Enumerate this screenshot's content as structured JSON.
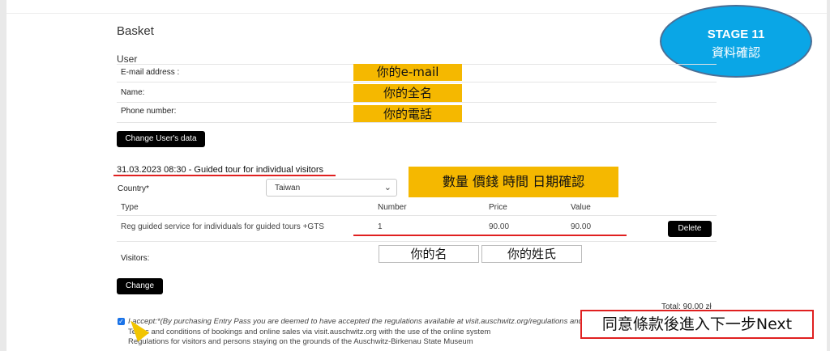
{
  "page": {
    "title": "Basket",
    "user_section": "User",
    "fields": [
      {
        "label": "E-mail address :",
        "annotation": "你的e-mail"
      },
      {
        "label": "Name:",
        "annotation": "你的全名"
      },
      {
        "label": "Phone number:",
        "annotation": "你的電話"
      }
    ],
    "change_user_button": "Change User's data"
  },
  "stage": {
    "line1": "STAGE 11",
    "line2": "資料確認"
  },
  "booking": {
    "heading": "31.03.2023 08:30 - Guided tour for individual visitors",
    "confirm_annotation": "數量 價錢 時間 日期確認",
    "country_label": "Country*",
    "country_value": "Taiwan",
    "columns": {
      "type": "Type",
      "number": "Number",
      "price": "Price",
      "value": "Value"
    },
    "row": {
      "type": "Reg guided service for individuals for guided tours +GTS",
      "number": "1",
      "price": "90.00",
      "value": "90.00"
    },
    "delete_button": "Delete",
    "visitors_label": "Visitors:",
    "visitor_first_name": "你的名",
    "visitor_last_name": "你的姓氏",
    "change_button": "Change"
  },
  "footer": {
    "total": "Total: 90.00 zł",
    "accept_text": "I accept:*(By purchasing Entry Pass you are deemed to have accepted the regulations available at visit.auschwitz.org/regulations and",
    "terms_line": "Terms and conditions of bookings and online sales via visit.auschwitz.org with the use of the online system",
    "regulations_line": "Regulations for visitors and persons staying on the grounds of the Auschwitz-Birkenau State Museum",
    "next_annotation": "同意條款後進入下一步Next"
  },
  "colors": {
    "highlight": "#f5b800",
    "stage_bubble": "#0aa6e6",
    "underline_red": "#e02020"
  }
}
